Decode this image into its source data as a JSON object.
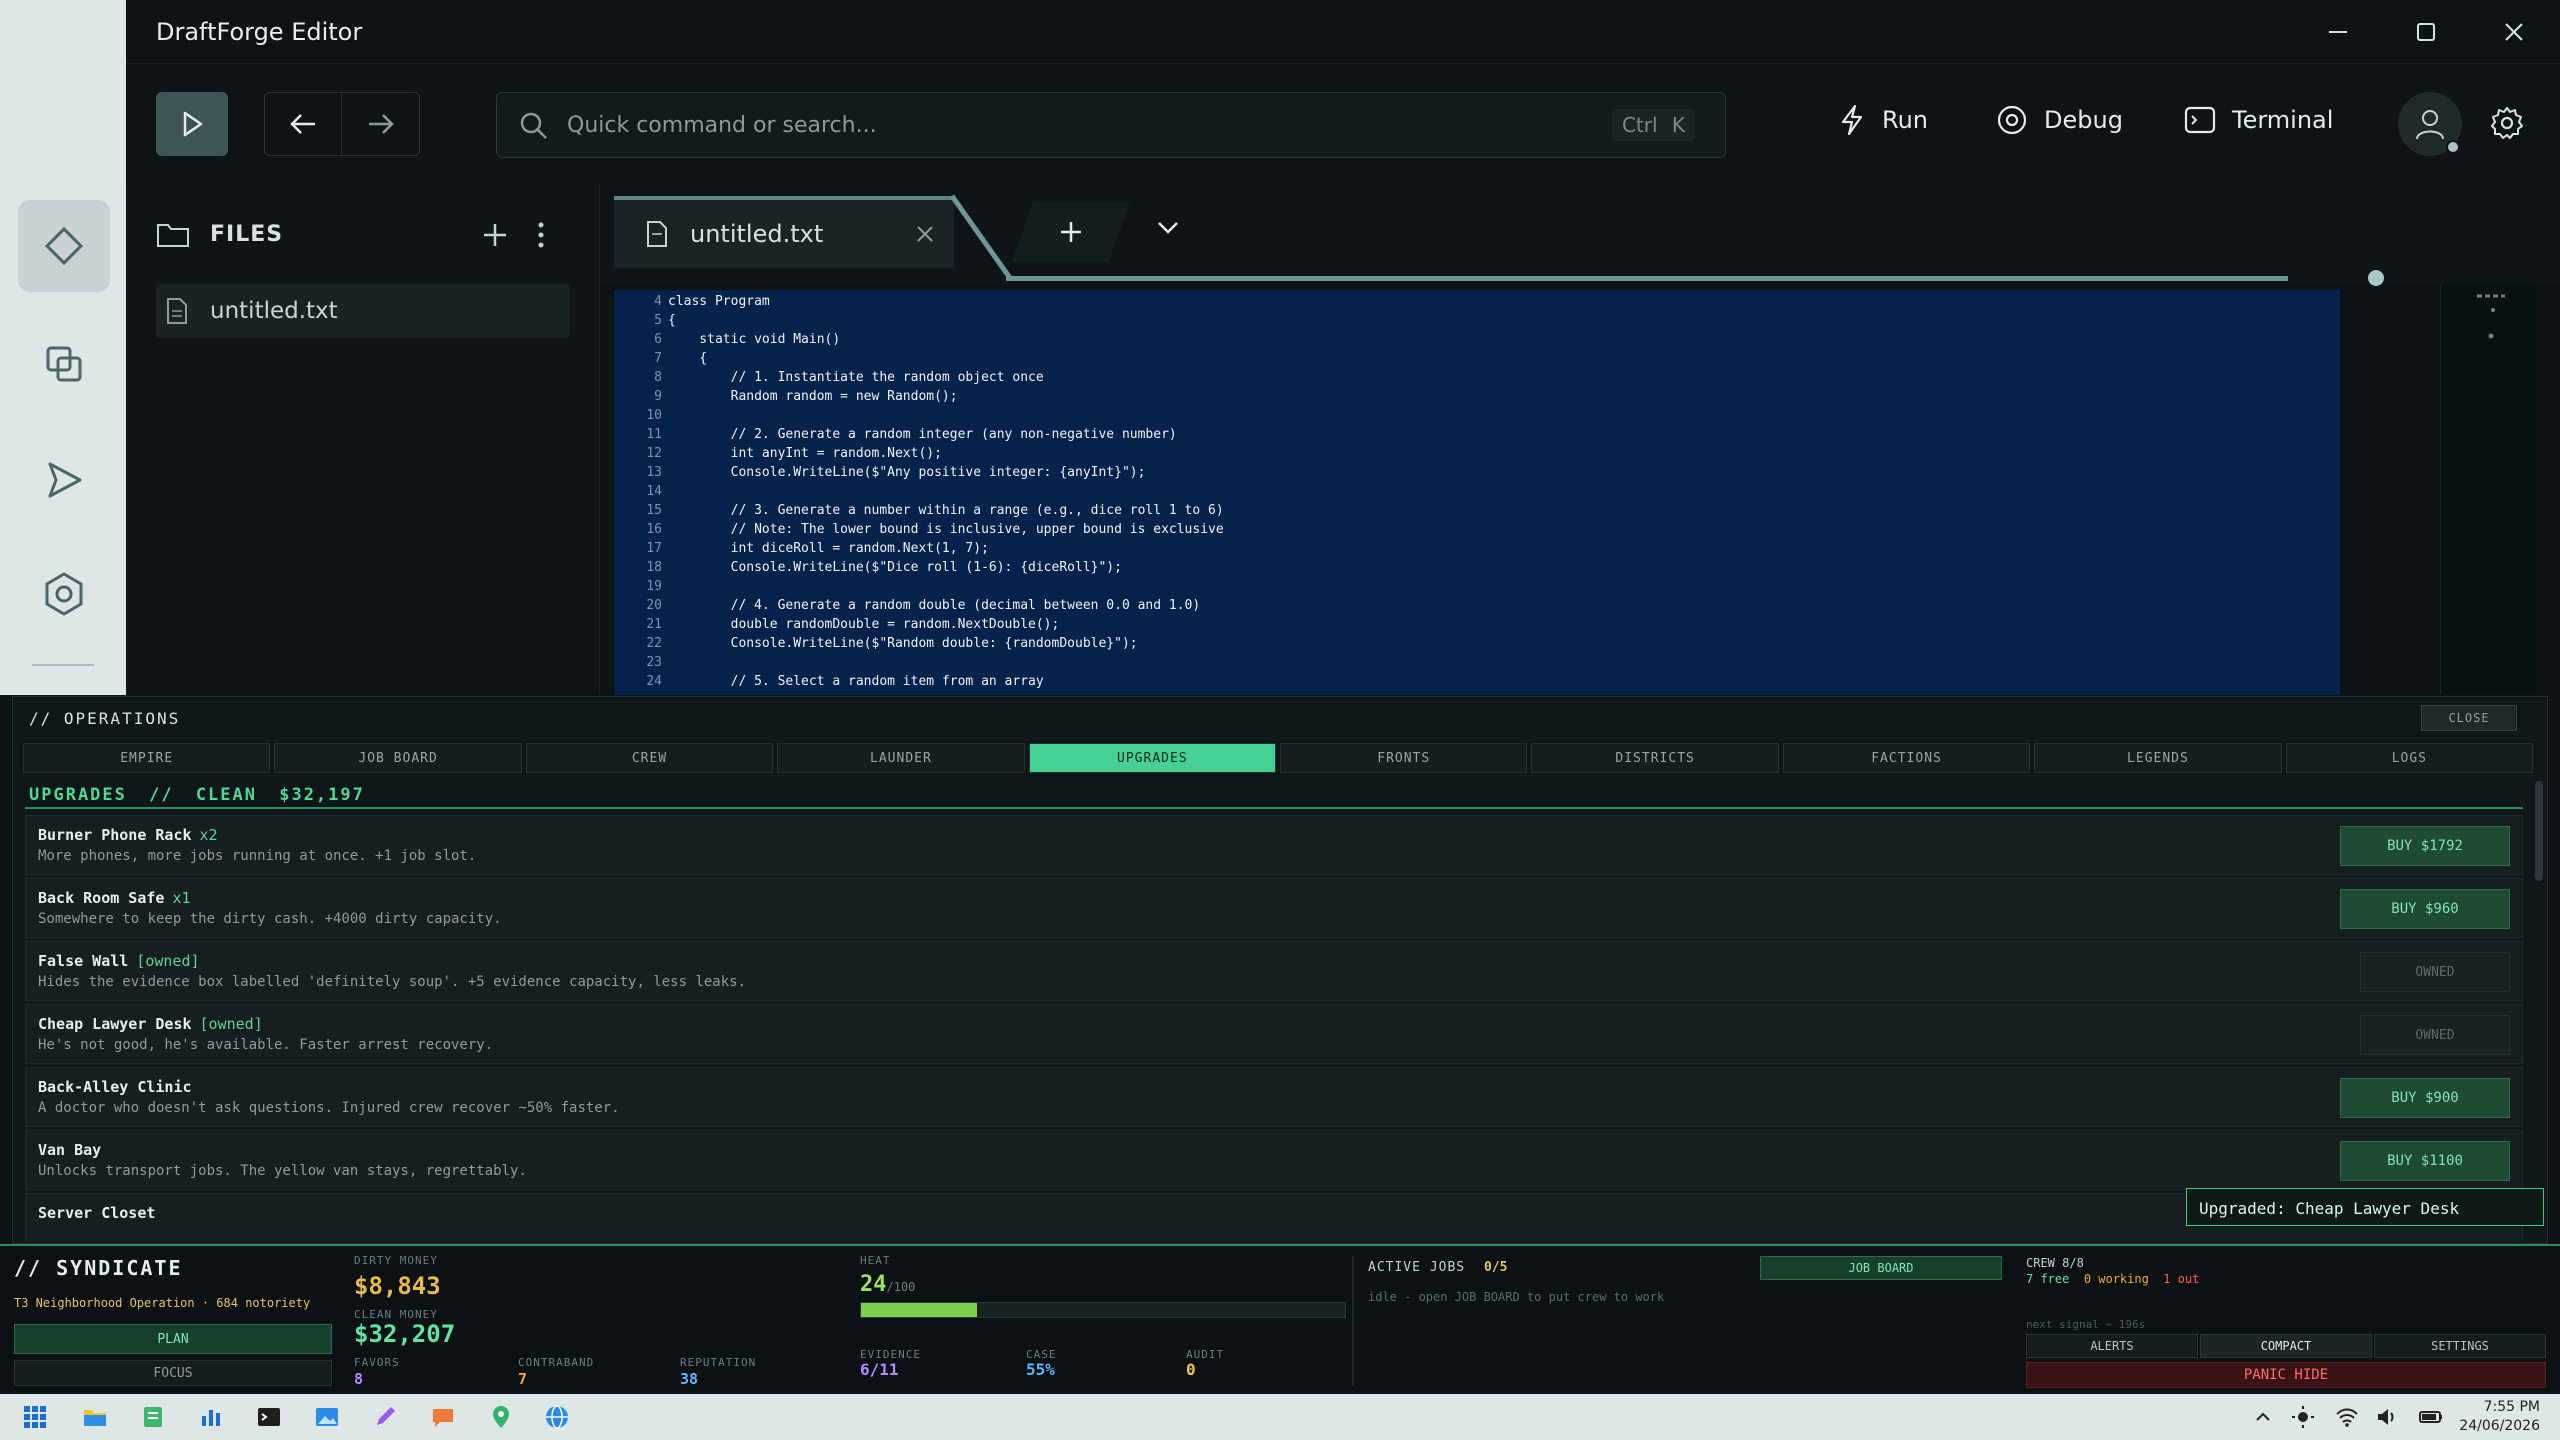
{
  "window": {
    "title": "DraftForge Editor"
  },
  "toolbar": {
    "search_placeholder": "Quick command or search...",
    "shortcut": "Ctrl K",
    "run_label": "Run",
    "debug_label": "Debug",
    "terminal_label": "Terminal"
  },
  "files": {
    "header": "FILES",
    "items": [
      "untitled.txt"
    ]
  },
  "tabs": {
    "active": "untitled.txt"
  },
  "code": [
    {
      "n": "4",
      "t": "class Program"
    },
    {
      "n": "5",
      "t": "{"
    },
    {
      "n": "6",
      "t": "    static void Main()"
    },
    {
      "n": "7",
      "t": "    {"
    },
    {
      "n": "8",
      "t": "        // 1. Instantiate the random object once"
    },
    {
      "n": "9",
      "t": "        Random random = new Random();"
    },
    {
      "n": "10",
      "t": ""
    },
    {
      "n": "11",
      "t": "        // 2. Generate a random integer (any non-negative number)"
    },
    {
      "n": "12",
      "t": "        int anyInt = random.Next();"
    },
    {
      "n": "13",
      "t": "        Console.WriteLine($\"Any positive integer: {anyInt}\");"
    },
    {
      "n": "14",
      "t": ""
    },
    {
      "n": "15",
      "t": "        // 3. Generate a number within a range (e.g., dice roll 1 to 6)"
    },
    {
      "n": "16",
      "t": "        // Note: The lower bound is inclusive, upper bound is exclusive"
    },
    {
      "n": "17",
      "t": "        int diceRoll = random.Next(1, 7);"
    },
    {
      "n": "18",
      "t": "        Console.WriteLine($\"Dice roll (1-6): {diceRoll}\");"
    },
    {
      "n": "19",
      "t": ""
    },
    {
      "n": "20",
      "t": "        // 4. Generate a random double (decimal between 0.0 and 1.0)"
    },
    {
      "n": "21",
      "t": "        double randomDouble = random.NextDouble();"
    },
    {
      "n": "22",
      "t": "        Console.WriteLine($\"Random double: {randomDouble}\");"
    },
    {
      "n": "23",
      "t": ""
    },
    {
      "n": "24",
      "t": "        // 5. Select a random item from an array"
    }
  ],
  "operations": {
    "title": "// OPERATIONS",
    "close": "CLOSE",
    "tabs": [
      "EMPIRE",
      "JOB BOARD",
      "CREW",
      "LAUNDER",
      "UPGRADES",
      "FRONTS",
      "DISTRICTS",
      "FACTIONS",
      "LEGENDS",
      "LOGS"
    ],
    "active_tab": "UPGRADES",
    "upgrades_header": "UPGRADES  //  CLEAN $32,197",
    "upgrades": [
      {
        "name": "Burner Phone Rack",
        "tag": "x2",
        "desc": "More phones, more jobs running at once. +1 job slot.",
        "action": "BUY $1792",
        "owned": false
      },
      {
        "name": "Back Room Safe",
        "tag": "x1",
        "desc": "Somewhere to keep the dirty cash. +4000 dirty capacity.",
        "action": "BUY $960",
        "owned": false
      },
      {
        "name": "False Wall",
        "tag": "[owned]",
        "desc": "Hides the evidence box labelled 'definitely soup'. +5 evidence capacity, less leaks.",
        "action": "OWNED",
        "owned": true
      },
      {
        "name": "Cheap Lawyer Desk",
        "tag": "[owned]",
        "desc": "He's not good, he's available. Faster arrest recovery.",
        "action": "OWNED",
        "owned": true
      },
      {
        "name": "Back-Alley Clinic",
        "tag": "",
        "desc": "A doctor who doesn't ask questions. Injured crew recover ~50% faster.",
        "action": "BUY $900",
        "owned": false
      },
      {
        "name": "Van Bay",
        "tag": "",
        "desc": "Unlocks transport jobs. The yellow van stays, regrettably.",
        "action": "BUY $1100",
        "owned": false
      },
      {
        "name": "Server Closet",
        "tag": "",
        "desc": "",
        "action": "",
        "owned": false
      }
    ],
    "toast": "Upgraded: Cheap Lawyer Desk"
  },
  "syndicate": {
    "title": "// SYNDICATE",
    "subtitle": "T3 Neighborhood Operation · 684 notoriety",
    "plan": "PLAN",
    "focus": "FOCUS",
    "dirty_label": "DIRTY MONEY",
    "dirty_value": "$8,843",
    "clean_label": "CLEAN MONEY",
    "clean_value": "$32,207",
    "favors_label": "FAVORS",
    "favors_value": "8",
    "contraband_label": "CONTRABAND",
    "contraband_value": "7",
    "reputation_label": "REPUTATION",
    "reputation_value": "38",
    "heat_label": "HEAT",
    "heat_value": "24",
    "heat_max": "/100",
    "heat_fraction": 0.24,
    "evidence_label": "EVIDENCE",
    "evidence_value": "6/11",
    "case_label": "CASE",
    "case_value": "55%",
    "audit_label": "AUDIT",
    "audit_value": "0",
    "jobs_label": "ACTIVE JOBS",
    "jobs_value": "0/5",
    "jobs_idle": "idle - open JOB BOARD to put crew to work",
    "job_board_btn": "JOB BOARD",
    "crew_label": "CREW 8/8",
    "crew_free": "7 free",
    "crew_working": "0 working",
    "crew_out": "1 out",
    "next_signal": "next signal ~ 196s",
    "alerts": "ALERTS",
    "compact": "COMPACT",
    "settings": "SETTINGS",
    "panic": "PANIC HIDE"
  },
  "taskbar": {
    "time": "7:55 PM",
    "date": "24/06/2026"
  }
}
